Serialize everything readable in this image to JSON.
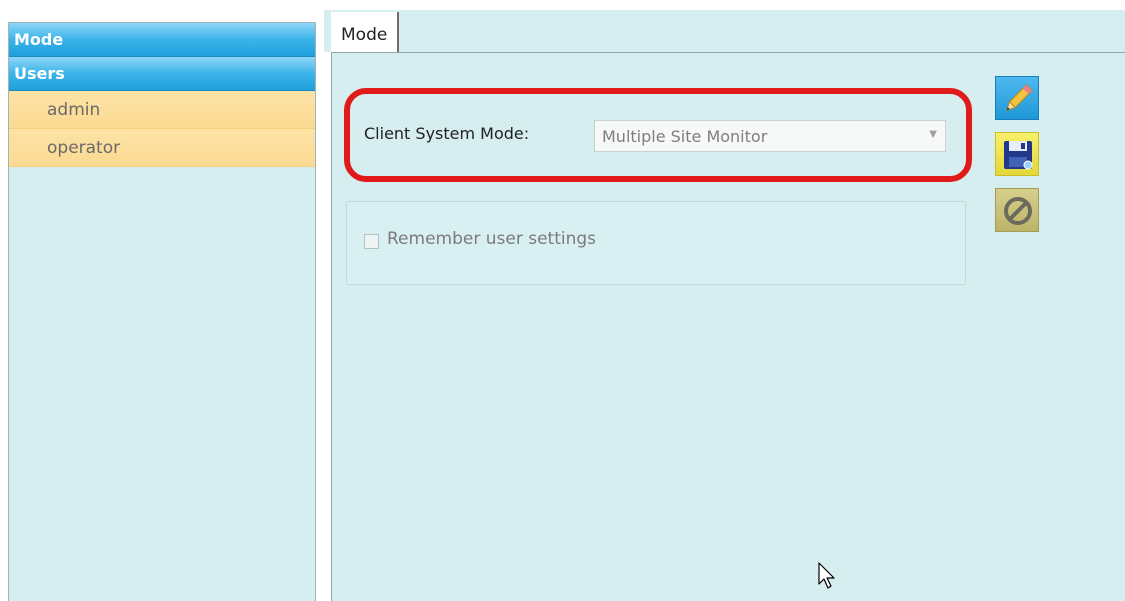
{
  "sidebar": {
    "headers": [
      {
        "label": "Mode"
      },
      {
        "label": "Users"
      }
    ],
    "users": [
      {
        "label": "admin"
      },
      {
        "label": "operator"
      }
    ]
  },
  "tabs": [
    {
      "label": "Mode",
      "active": true
    }
  ],
  "mode": {
    "label": "Client System Mode:",
    "selected": "Multiple Site Monitor",
    "highlight_color": "#e01a1a"
  },
  "settings": {
    "remember_user_settings": {
      "label": "Remember user settings",
      "checked": false
    }
  },
  "actions": {
    "edit_icon": "pencil-icon",
    "save_icon": "floppy-disk-icon",
    "cancel_icon": "cancel-circle-icon"
  },
  "colors": {
    "panel_background": "#d6eef0",
    "nav_header": "#3cb4ea",
    "nav_item": "#fbd991"
  }
}
